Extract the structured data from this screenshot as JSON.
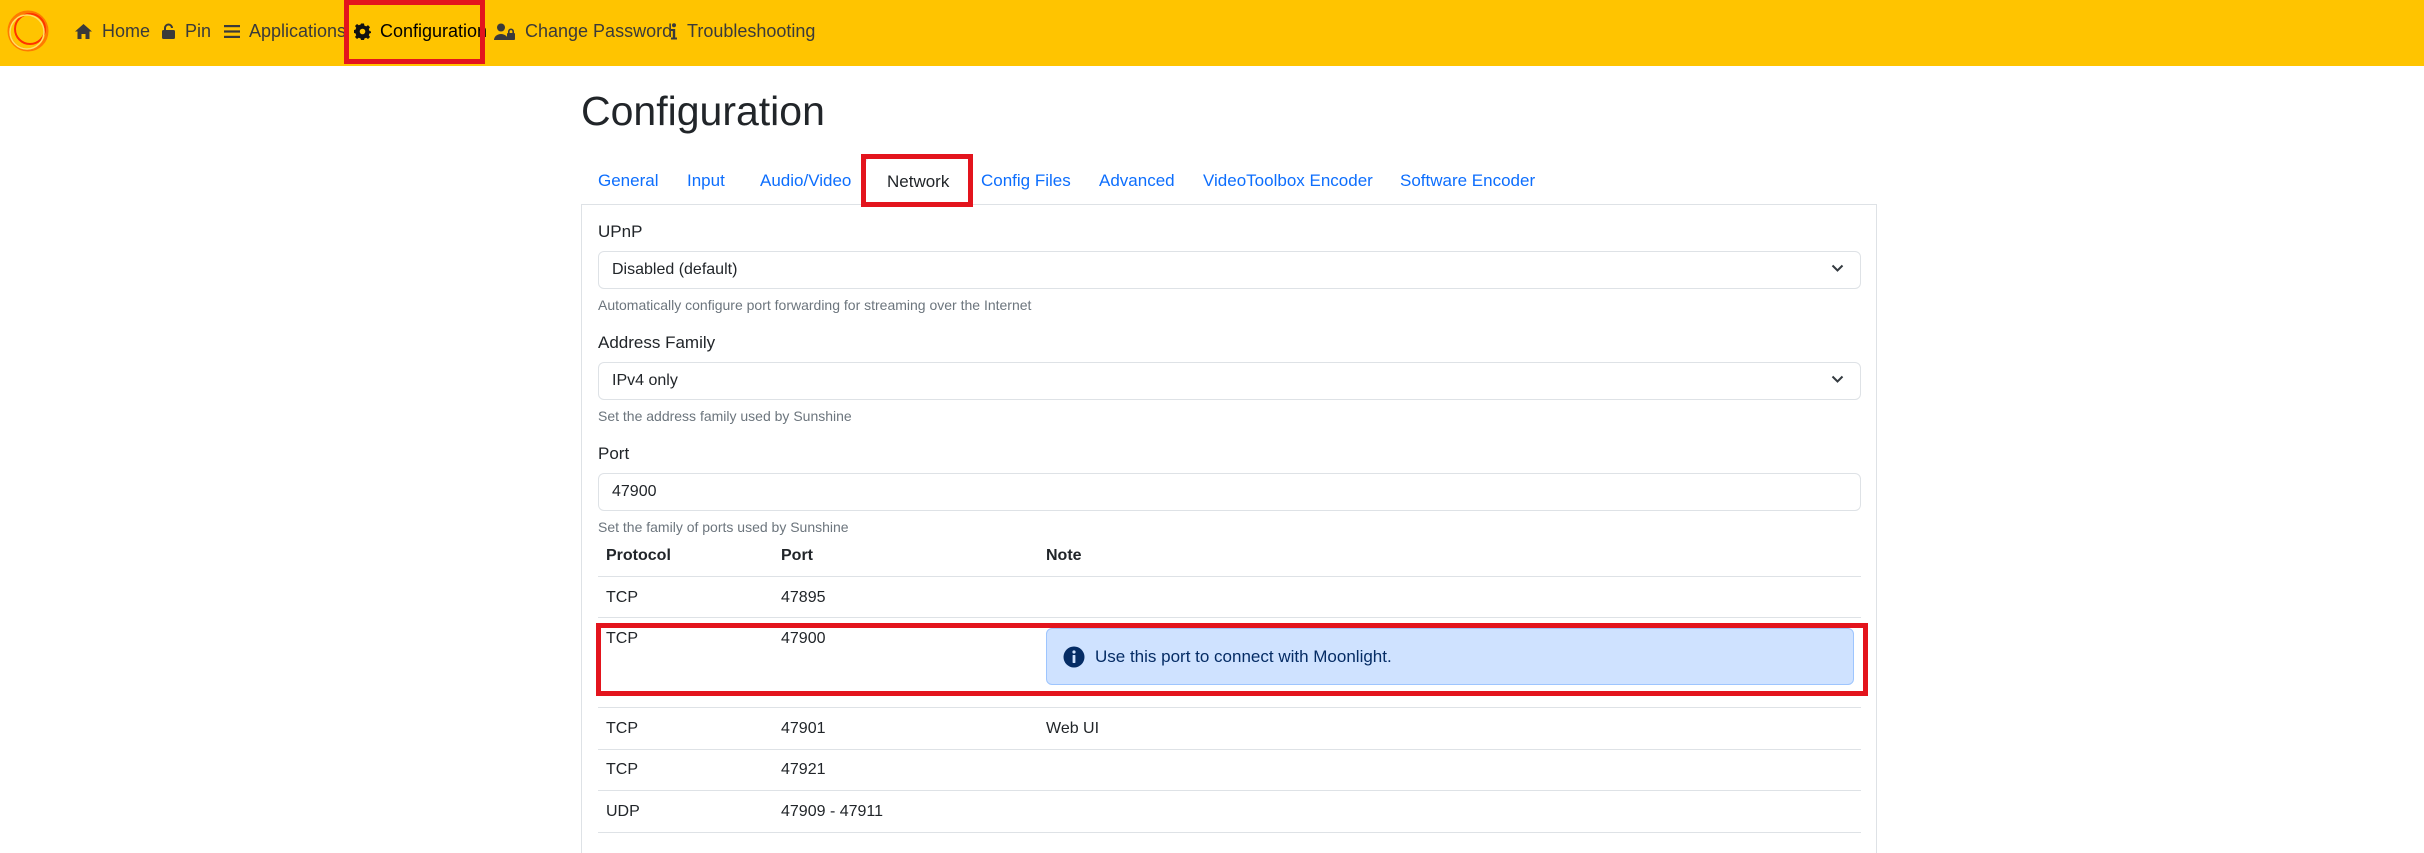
{
  "navbar": {
    "items": [
      {
        "label": "Home",
        "icon": "home-icon"
      },
      {
        "label": "Pin",
        "icon": "lock-icon"
      },
      {
        "label": "Applications",
        "icon": "list-icon"
      },
      {
        "label": "Configuration",
        "icon": "gear-icon",
        "active": true
      },
      {
        "label": "Change Password",
        "icon": "user-lock-icon"
      },
      {
        "label": "Troubleshooting",
        "icon": "info-icon"
      }
    ],
    "background": "#ffc400"
  },
  "page": {
    "title": "Configuration"
  },
  "tabs": [
    {
      "label": "General"
    },
    {
      "label": "Input"
    },
    {
      "label": "Audio/Video"
    },
    {
      "label": "Network",
      "active": true
    },
    {
      "label": "Config Files"
    },
    {
      "label": "Advanced"
    },
    {
      "label": "VideoToolbox Encoder"
    },
    {
      "label": "Software Encoder"
    }
  ],
  "network": {
    "upnp": {
      "label": "UPnP",
      "value": "Disabled (default)",
      "help": "Automatically configure port forwarding for streaming over the Internet"
    },
    "address_family": {
      "label": "Address Family",
      "value": "IPv4 only",
      "help": "Set the address family used by Sunshine"
    },
    "port": {
      "label": "Port",
      "value": "47900",
      "help": "Set the family of ports used by Sunshine"
    },
    "ports_table": {
      "headers": [
        "Protocol",
        "Port",
        "Note"
      ],
      "rows": [
        {
          "protocol": "TCP",
          "port": "47895",
          "note": ""
        },
        {
          "protocol": "TCP",
          "port": "47900",
          "note": "Use this port to connect with Moonlight."
        },
        {
          "protocol": "TCP",
          "port": "47901",
          "note": "Web UI"
        },
        {
          "protocol": "TCP",
          "port": "47921",
          "note": ""
        },
        {
          "protocol": "UDP",
          "port": "47909 - 47911",
          "note": ""
        }
      ]
    }
  },
  "colors": {
    "accent_link": "#0d6efd",
    "highlight": "#e3141d",
    "alert_bg": "#cfe2ff"
  }
}
